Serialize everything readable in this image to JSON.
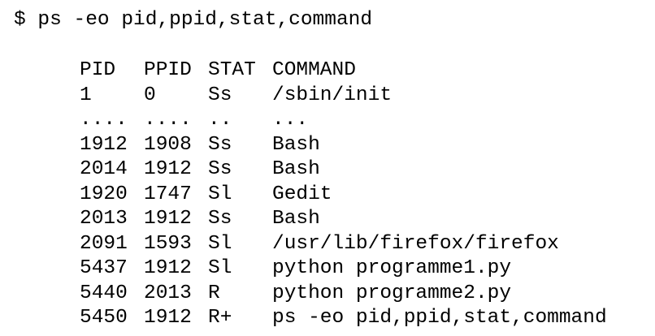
{
  "terminal": {
    "prompt": "$",
    "command": "ps -eo pid,ppid,stat,command"
  },
  "table": {
    "headers": [
      "PID",
      "PPID",
      "STAT",
      "COMMAND"
    ],
    "rows": [
      [
        "1",
        "0",
        "Ss",
        "/sbin/init"
      ],
      [
        "....",
        "....",
        "..",
        "..."
      ],
      [
        "1912",
        "1908",
        "Ss",
        "Bash"
      ],
      [
        "2014",
        "1912",
        "Ss",
        "Bash"
      ],
      [
        "1920",
        "1747",
        "Sl",
        "Gedit"
      ],
      [
        "2013",
        "1912",
        "Ss",
        "Bash"
      ],
      [
        "2091",
        "1593",
        "Sl",
        "/usr/lib/firefox/firefox"
      ],
      [
        "5437",
        "1912",
        "Sl",
        "python programme1.py"
      ],
      [
        "5440",
        "2013",
        "R",
        "python programme2.py"
      ],
      [
        "5450",
        "1912",
        "R+",
        "ps -eo pid,ppid,stat,command"
      ]
    ]
  }
}
